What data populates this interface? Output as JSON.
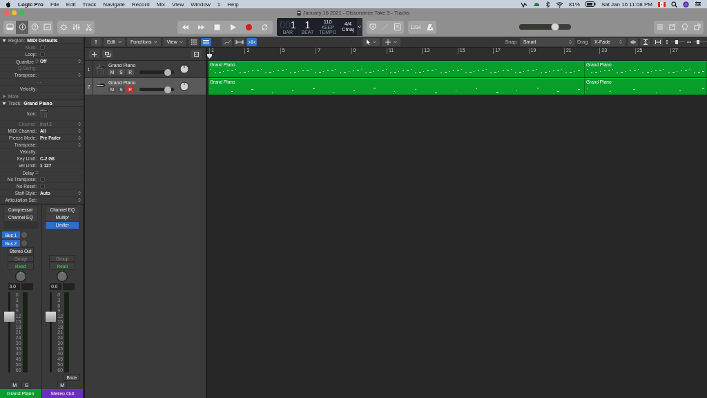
{
  "menu_bar": {
    "app": "Logic Pro",
    "items": [
      "File",
      "Edit",
      "Track",
      "Navigate",
      "Record",
      "Mix",
      "View",
      "Window",
      "1",
      "Help"
    ],
    "battery": "81%",
    "clock": "Sat Jan 16  11:08 PM"
  },
  "window": {
    "title": "January 16 2021 - Dissonance Take 3 - Tracks"
  },
  "control_bar": {
    "view_buttons": [
      {
        "kind": "library",
        "selected": false
      },
      {
        "kind": "info",
        "selected": true
      },
      {
        "kind": "help",
        "selected": false
      },
      {
        "kind": "editors",
        "selected": false
      }
    ],
    "tool_buttons": [
      {
        "kind": "dial"
      },
      {
        "kind": "mixer"
      },
      {
        "kind": "scissors"
      }
    ],
    "transport": [
      {
        "kind": "rewind"
      },
      {
        "kind": "forward"
      },
      {
        "kind": "stop"
      },
      {
        "kind": "play"
      },
      {
        "kind": "record"
      },
      {
        "kind": "cycle"
      }
    ],
    "lcd": {
      "bar_prefix": "00",
      "bar": "1",
      "beat": "1",
      "bar_label": "BAR",
      "beat_label": "BEAT",
      "tempo": "110",
      "tempo_mode": "KEEP",
      "tempo_label": "TEMPO",
      "signature": "4/4",
      "key": "Cmaj"
    },
    "solo_label": "S",
    "count_in": "1234",
    "master_volume": {
      "level": 0.7
    }
  },
  "inspector": {
    "region": {
      "title": "Region:",
      "name": "MIDI Defaults",
      "expanded": true,
      "rows": [
        {
          "kind": "checkbox",
          "label": "Mute:",
          "checked": false,
          "disabled": true
        },
        {
          "kind": "checkbox",
          "label": "Loop:",
          "checked": false,
          "disabled": false
        },
        {
          "kind": "stepper-popup",
          "label": "Quantize",
          "value": "Off",
          "disabled": false
        },
        {
          "kind": "text",
          "label": "Q-Swing:",
          "disabled": true
        },
        {
          "kind": "popup",
          "label": "Transpose:",
          "disabled": false
        },
        {
          "kind": "center",
          "value": "- -",
          "disabled": true
        },
        {
          "kind": "text",
          "label": "Velocity:",
          "disabled": false
        }
      ],
      "more": {
        "label": "More",
        "expanded": false
      }
    },
    "track": {
      "title": "Track:",
      "name": "Grand Piano",
      "expanded": true,
      "rows": [
        {
          "kind": "icon",
          "label": "Icon:",
          "disabled": false
        },
        {
          "kind": "popup",
          "label": "Channel:",
          "value": "Inst 2",
          "disabled": true
        },
        {
          "kind": "popup",
          "label": "MIDI Channel:",
          "value": "All",
          "disabled": false
        },
        {
          "kind": "popup",
          "label": "Freeze Mode:",
          "value": "Pre Fader",
          "disabled": false
        },
        {
          "kind": "popup",
          "label": "Transpose:",
          "disabled": false
        },
        {
          "kind": "text",
          "label": "Velocity:",
          "disabled": false
        },
        {
          "kind": "text",
          "label": "Key Limit:",
          "value": "C-2  G8",
          "disabled": false
        },
        {
          "kind": "text",
          "label": "Vel Limit:",
          "value": "1  127",
          "disabled": false
        },
        {
          "kind": "stepper",
          "label": "Delay",
          "disabled": false
        },
        {
          "kind": "checkbox",
          "label": "No Transpose:",
          "checked": false,
          "disabled": false
        },
        {
          "kind": "checkbox",
          "label": "No Reset:",
          "checked": false,
          "disabled": false
        },
        {
          "kind": "popup",
          "label": "Staff Style:",
          "value": "Auto",
          "disabled": false
        },
        {
          "kind": "popup",
          "label": "Articulation Set:",
          "disabled": false
        }
      ]
    },
    "strips": [
      {
        "inserts": [
          {
            "name": "Compressor",
            "selected": false
          },
          {
            "name": "Channel EQ",
            "selected": false
          }
        ],
        "sends": [
          {
            "name": "Bus 1"
          },
          {
            "name": "Bus 2"
          }
        ],
        "output": "Stereo Out",
        "group": "Group",
        "automation": "Read",
        "pan_value": "0.0",
        "level": 0.72,
        "meter_scale": [
          "0",
          "3",
          "6",
          "9",
          "12",
          "15",
          "18",
          "21",
          "24",
          "30",
          "35",
          "40",
          "45",
          "50",
          "60"
        ],
        "buttons": [
          "M",
          "S"
        ],
        "name": "Grand Piano",
        "color": "#0b9e2f"
      },
      {
        "inserts": [
          {
            "name": "Channel EQ",
            "selected": false
          },
          {
            "name": "Multipr",
            "selected": false
          },
          {
            "name": "Limiter",
            "selected": true
          }
        ],
        "group": "Group",
        "automation": "Read",
        "pan_value": "0.0",
        "level": 0.72,
        "meter_scale": [
          "0",
          "3",
          "6",
          "9",
          "12",
          "15",
          "18",
          "21",
          "24",
          "30",
          "35",
          "40",
          "45",
          "50",
          "60"
        ],
        "bounce": "Bnce",
        "buttons": [
          "M"
        ],
        "name": "Stereo Out",
        "color": "#6b2fc0"
      }
    ]
  },
  "tracks_area": {
    "menus": [
      "Edit",
      "Functions",
      "View"
    ],
    "tracks": [
      {
        "number": "1",
        "name": "Grand Piano",
        "mute": "M",
        "solo": "S",
        "record": "R",
        "record_armed": false,
        "selected": false,
        "level": 0.82
      },
      {
        "number": "2",
        "name": "Grand Piano",
        "mute": "M",
        "solo": "S",
        "record": "R",
        "record_armed": true,
        "selected": true,
        "level": 0.82
      }
    ],
    "snap_label": "Snap:",
    "snap": "Smart",
    "drag_label": "Drag:",
    "drag": "X-Fade",
    "vertical_zoom": {
      "level": 0.35
    },
    "horizontal_zoom": {
      "level": 0.3
    },
    "ruler": [
      "1",
      "3",
      "5",
      "7",
      "9",
      "11",
      "13",
      "15",
      "17",
      "19",
      "21",
      "23",
      "25",
      "27"
    ],
    "lanes": [
      {
        "regions": [
          {
            "name": "Grand Piano"
          },
          {
            "name": "Grand Piano"
          }
        ]
      },
      {
        "regions": [
          {
            "name": "Grand Piano"
          },
          {
            "name": "Grand Piano"
          }
        ]
      }
    ]
  }
}
